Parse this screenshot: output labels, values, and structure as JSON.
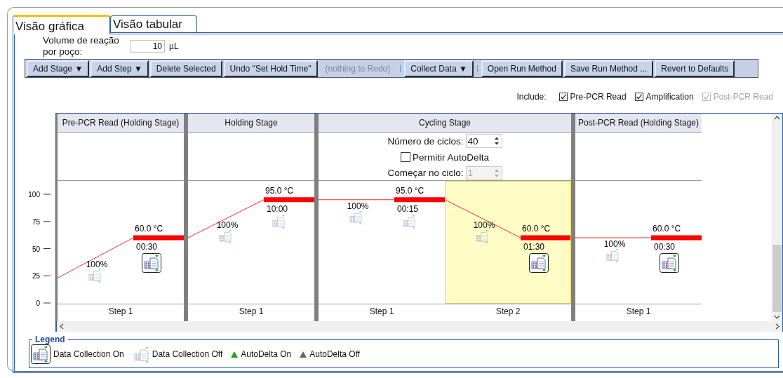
{
  "tabs": [
    {
      "label": "Visão gráfica",
      "selected": true
    },
    {
      "label": "Visão tabular",
      "selected": false
    }
  ],
  "reaction_volume": {
    "label": "Volume  de reação por poço:",
    "value": "10",
    "unit": "µL"
  },
  "toolbar": [
    {
      "kind": "button",
      "label": "Add Stage ▼",
      "disabled": false
    },
    {
      "kind": "button",
      "label": "Add Step ▼",
      "disabled": false
    },
    {
      "kind": "button",
      "label": "Delete Selected",
      "disabled": false
    },
    {
      "kind": "button",
      "label": "Undo \"Set Hold Time\"",
      "disabled": false
    },
    {
      "kind": "button",
      "label": "(nothing to Redo)",
      "disabled": true
    },
    {
      "kind": "separator"
    },
    {
      "kind": "button",
      "label": "Collect Data ▼",
      "disabled": false
    },
    {
      "kind": "separator"
    },
    {
      "kind": "button",
      "label": "Open Run Method",
      "disabled": false
    },
    {
      "kind": "button",
      "label": "Save Run Method ...",
      "disabled": false
    },
    {
      "kind": "button",
      "label": "Revert to Defaults",
      "disabled": false
    }
  ],
  "include": {
    "label": "Include:",
    "options": [
      {
        "label": "Pre-PCR Read",
        "checked": true,
        "disabled": false
      },
      {
        "label": "Amplification",
        "checked": true,
        "disabled": false
      },
      {
        "label": "Post-PCR Read",
        "checked": true,
        "disabled": true
      }
    ]
  },
  "y_axis": {
    "ticks": [
      "100",
      "75",
      "50",
      "25",
      "0"
    ]
  },
  "stages": [
    {
      "title": "Pre-PCR Read (Holding Stage)",
      "steps": [
        {
          "label": "Step 1",
          "temperature": "60.0 °C",
          "time": "00:30",
          "ramp": "100%",
          "ramp_collect": false,
          "hold_collect": true,
          "selected": false
        }
      ]
    },
    {
      "title": "Holding Stage",
      "steps": [
        {
          "label": "Step 1",
          "temperature": "95.0 °C",
          "time": "10:00",
          "ramp": "100%",
          "ramp_collect": false,
          "hold_collect": false,
          "selected": false
        }
      ]
    },
    {
      "title": "Cycling Stage",
      "cycle_settings": {
        "cycles": {
          "label": "Número de ciclos:",
          "value": "40"
        },
        "autodelta": {
          "label": "Permitir AutoDelta",
          "checked": false
        },
        "start_cycle": {
          "label": "Começar no ciclo:",
          "value": "1",
          "disabled": true
        }
      },
      "steps": [
        {
          "label": "Step 1",
          "temperature": "95.0 °C",
          "time": "00:15",
          "ramp": "100%",
          "ramp_collect": false,
          "hold_collect": false,
          "selected": false
        },
        {
          "label": "Step 2",
          "temperature": "60.0 °C",
          "time": "01:30",
          "ramp": "100%",
          "ramp_collect": false,
          "hold_collect": true,
          "selected": true
        }
      ]
    },
    {
      "title": "Post-PCR Read (Holding Stage)",
      "steps": [
        {
          "label": "Step 1",
          "temperature": "60.0 °C",
          "time": "00:30",
          "ramp": "100%",
          "ramp_collect": false,
          "hold_collect": true,
          "selected": false
        }
      ]
    }
  ],
  "legend": {
    "title": "Legend",
    "items": [
      {
        "kind": "collect_on",
        "label": "Data Collection On"
      },
      {
        "kind": "collect_off",
        "label": "Data Collection Off"
      },
      {
        "kind": "autodelta_on",
        "label": "AutoDelta On"
      },
      {
        "kind": "autodelta_off",
        "label": "AutoDelta Off"
      }
    ]
  }
}
